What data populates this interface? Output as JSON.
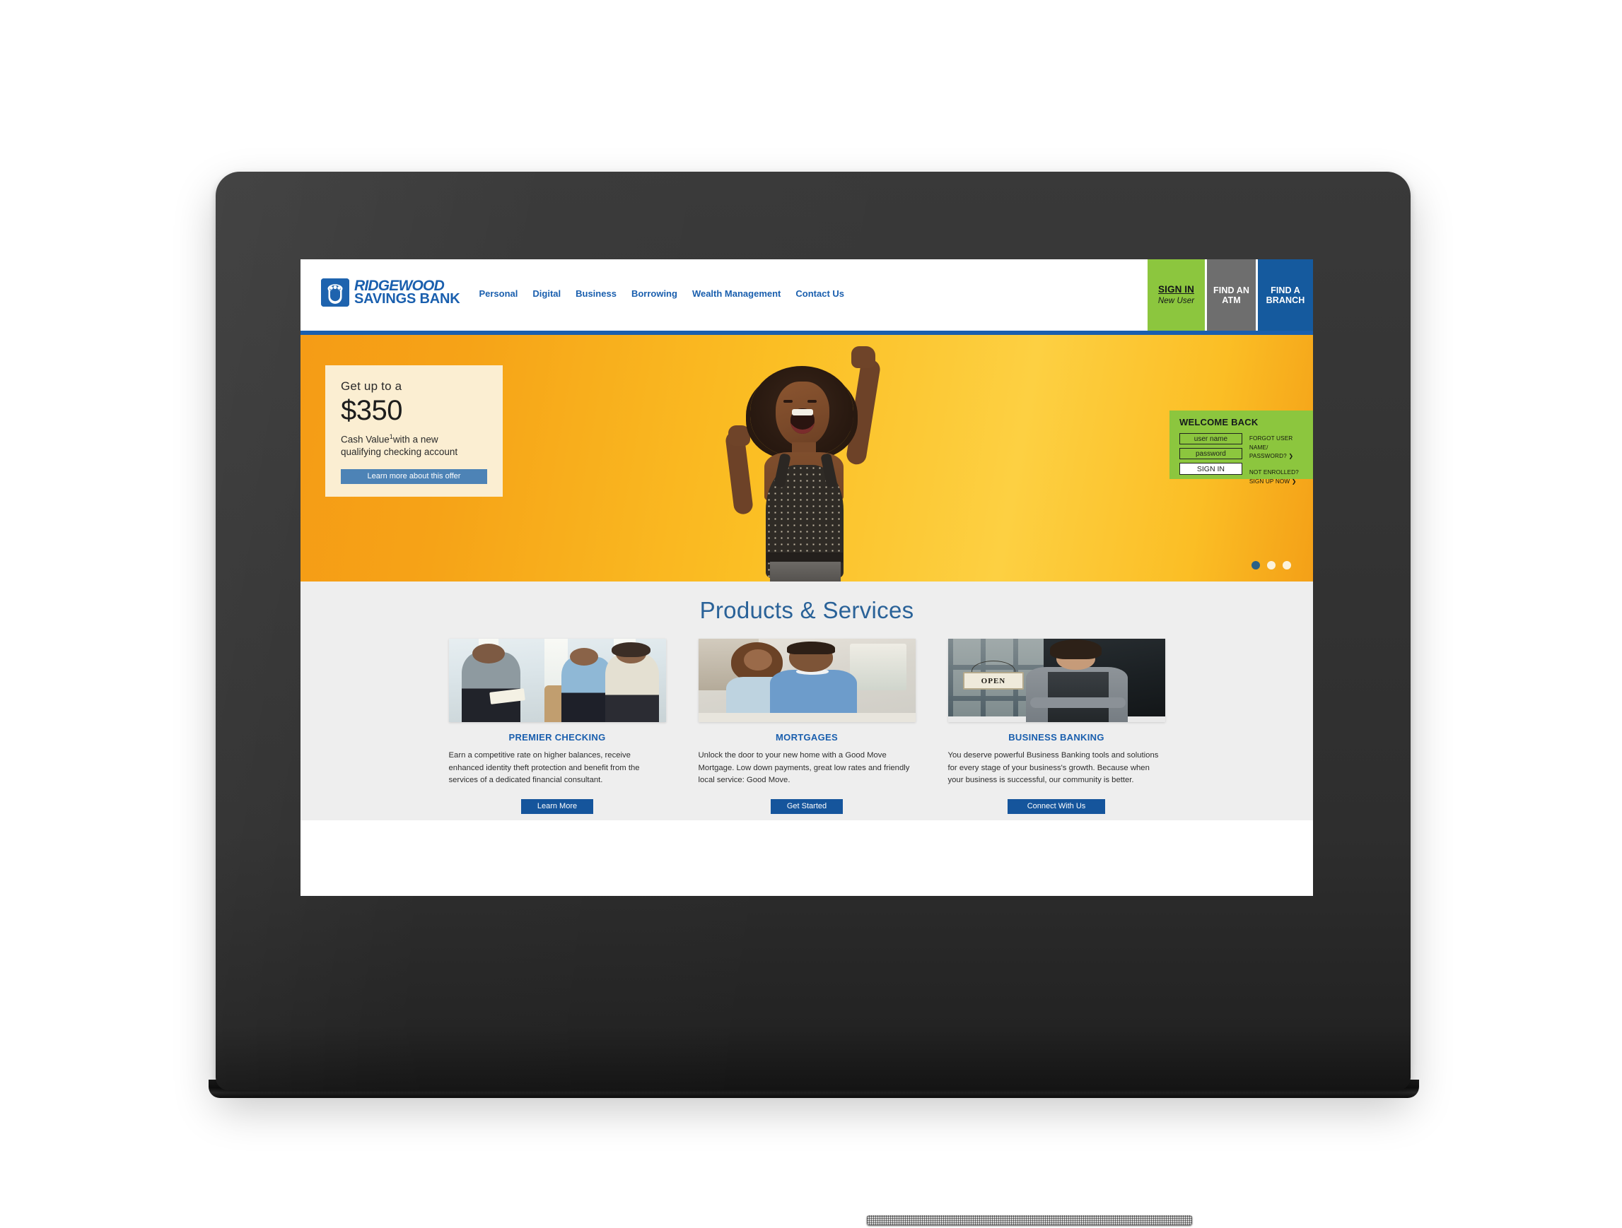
{
  "site": {
    "brand": {
      "line1": "RIDGEWOOD",
      "line2": "SAVINGS BANK",
      "logo_icon": "acorn-shield-icon",
      "color": "#1a5fae"
    },
    "nav": [
      {
        "label": "Personal"
      },
      {
        "label": "Digital"
      },
      {
        "label": "Business"
      },
      {
        "label": "Borrowing"
      },
      {
        "label": "Wealth Management"
      },
      {
        "label": "Contact Us"
      }
    ],
    "header_actions": {
      "sign_in": {
        "main": "SIGN IN",
        "sub": "New User",
        "color": "#8cc63e"
      },
      "find_atm": {
        "line1": "FIND AN",
        "line2": "ATM",
        "color": "#6e6e6e"
      },
      "find_branch": {
        "line1": "FIND A",
        "line2": "BRANCH",
        "color": "#155a9e"
      }
    }
  },
  "hero": {
    "background_color": "#fbbf24",
    "promo": {
      "kicker": "Get up to a",
      "amount": "$350",
      "sub_line1": "Cash Value",
      "sub_footnote": "1",
      "sub_line2": "with a new",
      "sub_line3": "qualifying checking account",
      "button_label": "Learn more about this offer",
      "button_color": "#4d83b6",
      "card_color": "#fbeed2"
    },
    "model_alt": "cheering-woman-photo",
    "carousel": {
      "total_dots": 3,
      "active_index": 0,
      "active_color": "#2c6186",
      "inactive_color": "#fbf2dc"
    }
  },
  "login": {
    "title": "WELCOME BACK",
    "panel_color": "#8cc63e",
    "username_placeholder": "user name",
    "username_value": "",
    "password_placeholder": "password",
    "password_value": "",
    "submit_label": "SIGN IN",
    "links": {
      "forgot_line1": "FORGOT USER NAME/",
      "forgot_line2": "PASSWORD? ❯",
      "enroll_line1": "NOT ENROLLED?",
      "enroll_line2": "SIGN UP NOW ❯"
    }
  },
  "products": {
    "heading": "Products & Services",
    "heading_color": "#2a6298",
    "cards": [
      {
        "image_alt": "financial-advisor-meeting-photo",
        "title": "PREMIER CHECKING",
        "body": "Earn a competitive rate on higher balances, receive enhanced identity theft protection and benefit from the services of a dedicated financial consultant.",
        "button_label": "Learn More"
      },
      {
        "image_alt": "smiling-couple-at-home-photo",
        "title": "MORTGAGES",
        "body": "Unlock the door to your new home with a Good Move Mortgage. Low down payments, great low rates and friendly local service: Good Move.",
        "button_label": "Get Started"
      },
      {
        "image_alt": "shop-owner-open-sign-photo",
        "title": "BUSINESS BANKING",
        "body": "You deserve powerful Business Banking tools and solutions for every stage of your business's growth. Because when your business is successful, our community is better.",
        "button_label": "Connect With Us"
      }
    ],
    "open_sign_text": "OPEN",
    "button_color": "#15559c",
    "section_background": "#eeeeee"
  },
  "device": {
    "type": "tablet",
    "bezel_color": "#2e2e2e"
  }
}
